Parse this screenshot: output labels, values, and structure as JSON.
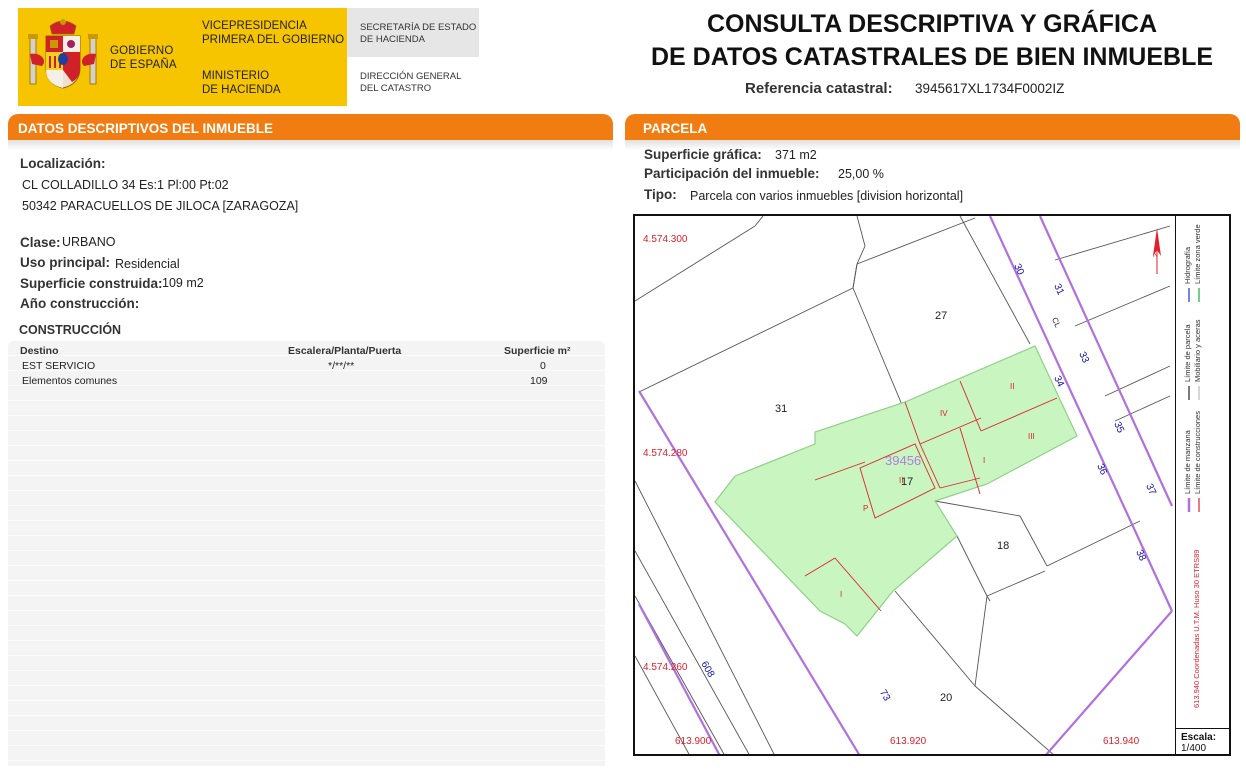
{
  "header": {
    "gobierno": [
      "GOBIERNO",
      "DE ESPAÑA"
    ],
    "vicepresidencia": [
      "VICEPRESIDENCIA",
      "PRIMERA DEL GOBIERNO"
    ],
    "ministerio": [
      "MINISTERIO",
      "DE HACIENDA"
    ],
    "secretaria": [
      "SECRETARÍA DE ESTADO",
      "DE HACIENDA"
    ],
    "direccion": [
      "DIRECCIÓN GENERAL",
      "DEL CATASTRO"
    ],
    "title_line1": "CONSULTA DESCRIPTIVA Y GRÁFICA",
    "title_line2": "DE DATOS CATASTRALES DE BIEN INMUEBLE",
    "ref_label": "Referencia catastral:",
    "ref_value": "3945617XL1734F0002IZ"
  },
  "descriptivos": {
    "section_title": "DATOS DESCRIPTIVOS DEL INMUEBLE",
    "localizacion_label": "Localización:",
    "localizacion_line1": "CL COLLADILLO 34 Es:1 Pl:00 Pt:02",
    "localizacion_line2": "50342 PARACUELLOS DE JILOCA [ZARAGOZA]",
    "clase_label": "Clase:",
    "clase_value": "URBANO",
    "uso_label": "Uso principal:",
    "uso_value": "Residencial",
    "superficie_label": "Superficie construida:",
    "superficie_value": "109 m2",
    "anio_label": "Año construcción:",
    "anio_value": ""
  },
  "construccion": {
    "title": "CONSTRUCCIÓN",
    "headers": [
      "Destino",
      "Escalera/Planta/Puerta",
      "Superficie m²"
    ],
    "rows": [
      {
        "destino": "EST SERVICIO",
        "planta": "*/**/**",
        "superficie": "0"
      },
      {
        "destino": "Elementos comunes",
        "planta": "",
        "superficie": "109"
      }
    ]
  },
  "parcela": {
    "section_title": "PARCELA",
    "superficie_label": "Superficie gráfica:",
    "superficie_value": "371 m2",
    "participacion_label": "Participación del inmueble:",
    "participacion_value": "25,00 %",
    "tipo_label": "Tipo:",
    "tipo_value": "Parcela con varios inmuebles [division horizontal]"
  },
  "map": {
    "colors": {
      "parcel_fill": "#c8f5c0",
      "parcel_stroke": "#8fd088",
      "buildings": "#e0202a",
      "manzana": "#b070e0",
      "labels_red": "#e0202a",
      "labels_blue": "#1010aa",
      "ref_label": "#b080e0"
    },
    "y_coords": [
      "4.574.300",
      "4.574.280",
      "4.574.260"
    ],
    "x_coords": [
      "613.900",
      "613.920",
      "613.940"
    ],
    "parcel_numbers": [
      "27",
      "31",
      "17",
      "18",
      "20"
    ],
    "ref_label": "39456",
    "street_numbers": [
      "30",
      "31",
      "33",
      "34",
      "35",
      "36",
      "37",
      "38",
      "73",
      "608"
    ],
    "street_name": "CL",
    "building_labels": [
      "II",
      "IV",
      "III",
      "I",
      "II",
      "P",
      "I"
    ],
    "legend": [
      "Límite de manzana",
      "Límite de construcciones",
      "Límite de parcela",
      "Mobiliario y aceras",
      "Hidrografía",
      "Límite zona verde"
    ],
    "coords_note": "613.940 Coordenadas U.T.M. Huso 30 ETRS89",
    "north_label": "N",
    "scale_label": "Escala:",
    "scale_value": "1/400"
  }
}
